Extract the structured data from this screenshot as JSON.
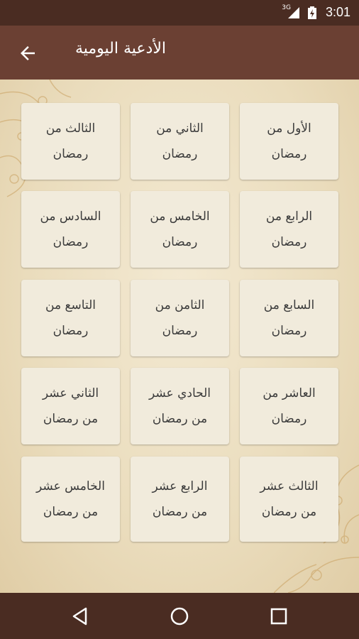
{
  "status_bar": {
    "network": "3G",
    "time": "3:01"
  },
  "app_bar": {
    "title": "الأدعية اليومية"
  },
  "tiles": [
    "الأول من رمضان",
    "الثاني من رمضان",
    "الثالث من رمضان",
    "الرابع من رمضان",
    "الخامس من رمضان",
    "السادس من رمضان",
    "السابع من رمضان",
    "الثامن من رمضان",
    "التاسع من رمضان",
    "العاشر من رمضان",
    "الحادي عشر من رمضان",
    "الثاني عشر من رمضان",
    "الثالث عشر من رمضان",
    "الرابع عشر من رمضان",
    "الخامس عشر من رمضان"
  ],
  "colors": {
    "app_bar": "#6b4033",
    "status_bar": "#4a2c22",
    "tile": "#f1ebdc",
    "background": "#eadcbc"
  }
}
